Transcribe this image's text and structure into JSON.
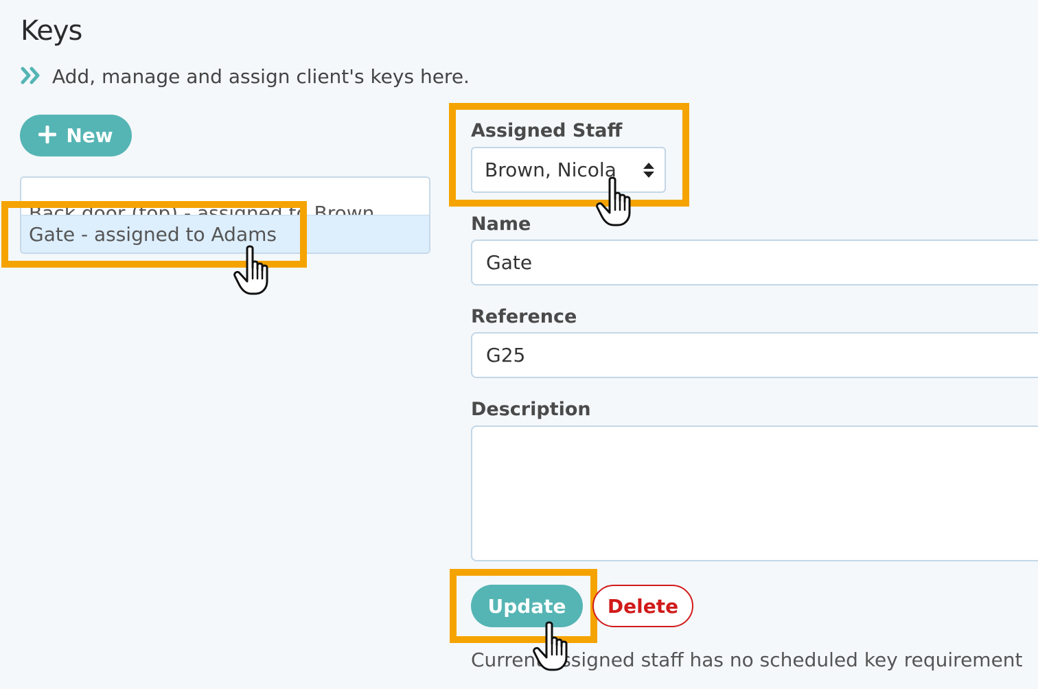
{
  "page": {
    "title": "Keys",
    "subtitle": "Add, manage and assign client's keys here."
  },
  "toolbar": {
    "new_label": "New"
  },
  "key_list": {
    "items": [
      {
        "label": "Back door (top) - assigned to Brown"
      },
      {
        "label": "Gate - assigned to Adams"
      }
    ]
  },
  "form": {
    "assigned_staff_label": "Assigned Staff",
    "assigned_staff_value": "Brown, Nicola",
    "name_label": "Name",
    "name_value": "Gate",
    "reference_label": "Reference",
    "reference_value": "G25",
    "description_label": "Description",
    "description_value": "",
    "update_label": "Update",
    "delete_label": "Delete",
    "status_text": "Current assigned staff has no scheduled key requirement"
  },
  "colors": {
    "accent": "#55b5b4",
    "danger": "#d11a1a",
    "highlight": "#f5a300",
    "selected_row": "#ddeefd"
  },
  "icons": {
    "subtitle_icon": "double-chevron-right-icon",
    "new_icon": "plus-icon",
    "select_icon": "sort-arrows-icon",
    "cursor_icon": "hand-pointer-icon"
  }
}
